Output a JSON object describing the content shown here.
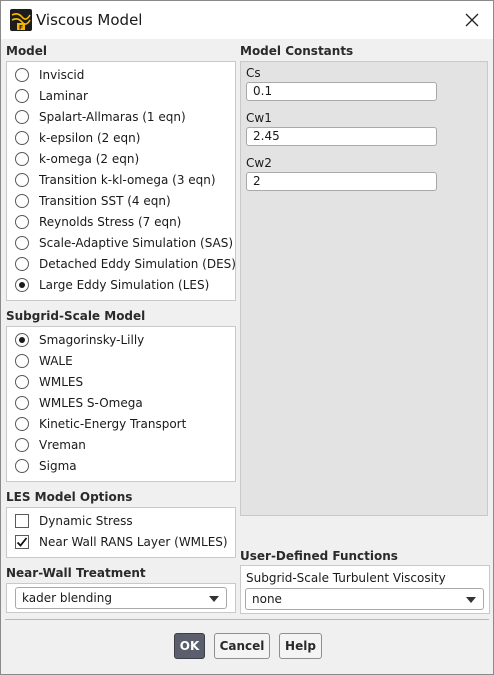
{
  "window": {
    "title": "Viscous Model"
  },
  "model": {
    "label": "Model",
    "options": [
      {
        "label": "Inviscid",
        "selected": false
      },
      {
        "label": "Laminar",
        "selected": false
      },
      {
        "label": "Spalart-Allmaras (1 eqn)",
        "selected": false
      },
      {
        "label": "k-epsilon (2 eqn)",
        "selected": false
      },
      {
        "label": "k-omega (2 eqn)",
        "selected": false
      },
      {
        "label": "Transition k-kl-omega (3 eqn)",
        "selected": false
      },
      {
        "label": "Transition SST (4 eqn)",
        "selected": false
      },
      {
        "label": "Reynolds Stress (7 eqn)",
        "selected": false
      },
      {
        "label": "Scale-Adaptive Simulation (SAS)",
        "selected": false
      },
      {
        "label": "Detached Eddy Simulation (DES)",
        "selected": false
      },
      {
        "label": "Large Eddy Simulation (LES)",
        "selected": true
      }
    ]
  },
  "subgrid": {
    "label": "Subgrid-Scale Model",
    "options": [
      {
        "label": "Smagorinsky-Lilly",
        "selected": true
      },
      {
        "label": "WALE",
        "selected": false
      },
      {
        "label": "WMLES",
        "selected": false
      },
      {
        "label": "WMLES S-Omega",
        "selected": false
      },
      {
        "label": "Kinetic-Energy Transport",
        "selected": false
      },
      {
        "label": "Vreman",
        "selected": false
      },
      {
        "label": "Sigma",
        "selected": false
      }
    ]
  },
  "les_options": {
    "label": "LES Model Options",
    "items": [
      {
        "label": "Dynamic Stress",
        "checked": false
      },
      {
        "label": "Near Wall RANS Layer (WMLES)",
        "checked": true
      }
    ]
  },
  "near_wall": {
    "label": "Near-Wall Treatment",
    "value": "kader blending"
  },
  "constants": {
    "label": "Model Constants",
    "items": [
      {
        "name": "Cs",
        "value": "0.1"
      },
      {
        "name": "Cw1",
        "value": "2.45"
      },
      {
        "name": "Cw2",
        "value": "2"
      }
    ]
  },
  "udf": {
    "label": "User-Defined Functions",
    "field_label": "Subgrid-Scale Turbulent Viscosity",
    "value": "none"
  },
  "buttons": {
    "ok": "OK",
    "cancel": "Cancel",
    "help": "Help"
  }
}
